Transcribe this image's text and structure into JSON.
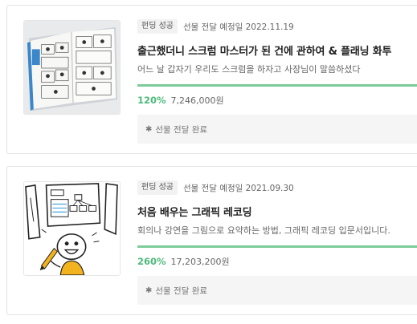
{
  "projects": [
    {
      "badge": "펀딩 성공",
      "delivery": "선물 전달 예정일 2022.11.19",
      "title": "출근했더니 스크럼 마스터가 된 건에 관하여 & 플래닝 화투",
      "description": "어느 날 갑자기 우리도 스크럼을 하자고 사장님이 말씀하셨다",
      "progress_percent": 120,
      "percent_label": "120%",
      "amount": "7,246,000원",
      "status": "선물 전달 완료",
      "status_icon": "asterisk-icon",
      "thumbnail": "open-book-comic-image"
    },
    {
      "badge": "펀딩 성공",
      "delivery": "선물 전달 예정일 2021.09.30",
      "title": "처음 배우는 그래픽 레코딩",
      "description": "회의나 강연을 그림으로 요약하는 방법, 그래픽 레코딩 입문서입니다.",
      "progress_percent": 260,
      "percent_label": "260%",
      "amount": "17,203,200원",
      "status": "선물 전달 완료",
      "status_icon": "asterisk-icon",
      "thumbnail": "graphic-recording-doodle-image"
    }
  ],
  "colors": {
    "accent": "#4dbb7b",
    "bar": "#7ccc9a",
    "badge_bg": "#f2f2f2",
    "status_bg": "#f5f5f5"
  }
}
